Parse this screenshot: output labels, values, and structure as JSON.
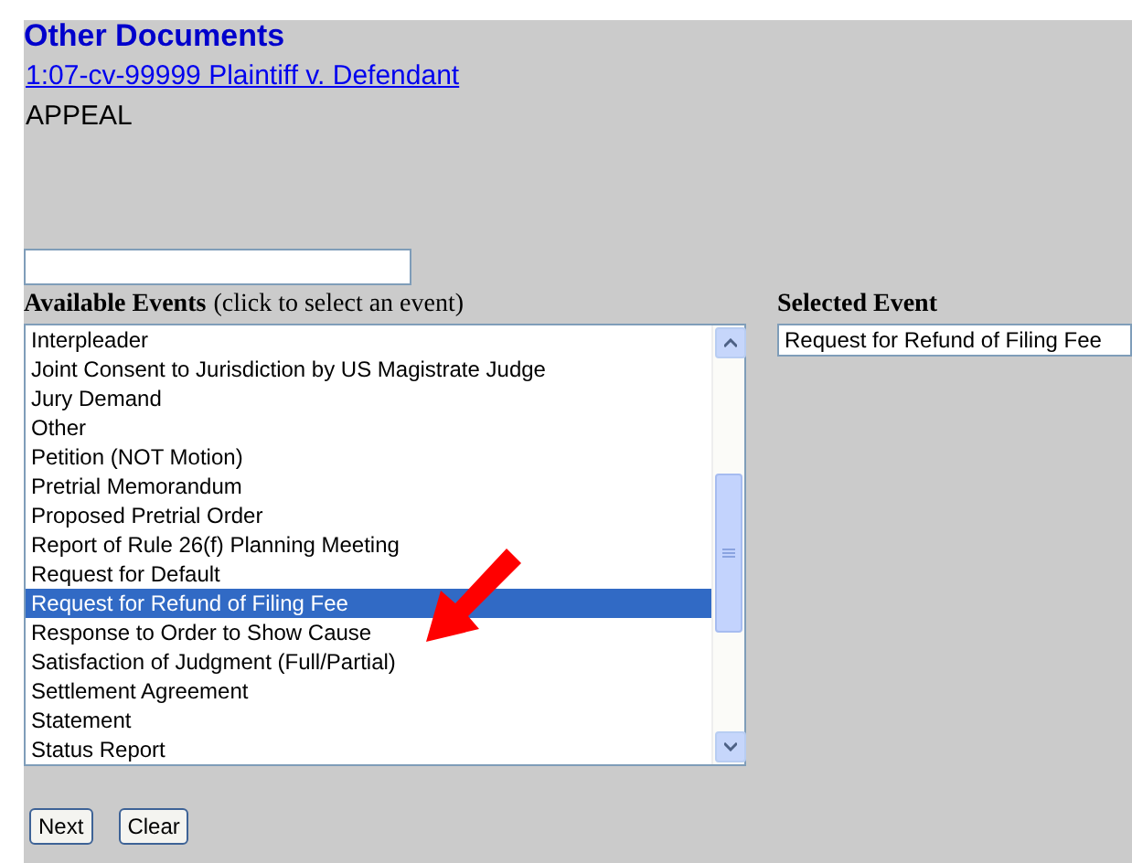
{
  "title": "Other Documents",
  "case_link": "1:07-cv-99999 Plaintiff v. Defendant",
  "case_type": "APPEAL",
  "available_events": {
    "label": "Available Events",
    "hint": "(click to select an event)",
    "items": [
      {
        "label": "Interpleader",
        "selected": false
      },
      {
        "label": "Joint Consent to Jurisdiction by US Magistrate Judge",
        "selected": false
      },
      {
        "label": "Jury Demand",
        "selected": false
      },
      {
        "label": "Other",
        "selected": false
      },
      {
        "label": "Petition (NOT Motion)",
        "selected": false
      },
      {
        "label": "Pretrial Memorandum",
        "selected": false
      },
      {
        "label": "Proposed Pretrial Order",
        "selected": false
      },
      {
        "label": "Report of Rule 26(f) Planning Meeting",
        "selected": false
      },
      {
        "label": "Request for Default",
        "selected": false
      },
      {
        "label": "Request for Refund of Filing Fee",
        "selected": true
      },
      {
        "label": "Response to Order to Show Cause",
        "selected": false
      },
      {
        "label": "Satisfaction of Judgment (Full/Partial)",
        "selected": false
      },
      {
        "label": "Settlement Agreement",
        "selected": false
      },
      {
        "label": "Statement",
        "selected": false
      },
      {
        "label": "Status Report",
        "selected": false
      }
    ]
  },
  "selected_event": {
    "label": "Selected Event",
    "value": "Request for Refund of Filing Fee"
  },
  "buttons": [
    "Next",
    "Clear"
  ]
}
